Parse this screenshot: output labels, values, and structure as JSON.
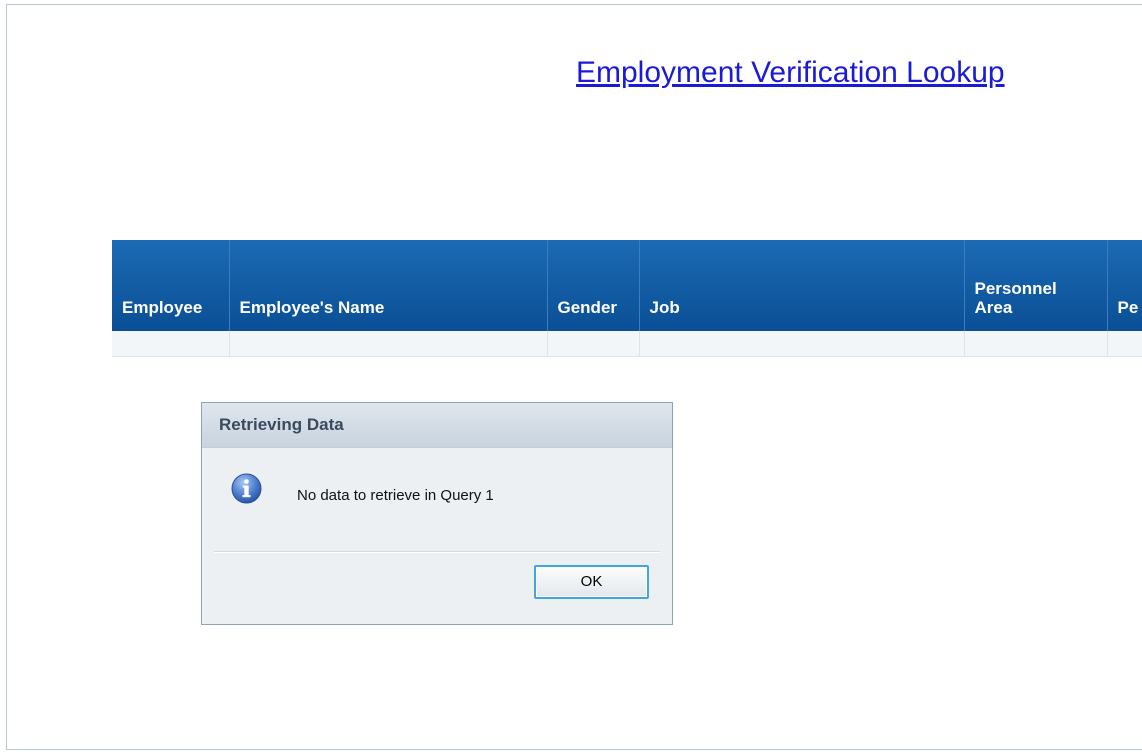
{
  "page": {
    "title": "Employment Verification Lookup"
  },
  "table": {
    "columns": [
      "Employee",
      "Employee's Name",
      "Gender",
      "Job",
      "Personnel\nArea",
      "Pe"
    ],
    "rows": [
      [
        "",
        "",
        "",
        "",
        "",
        ""
      ]
    ]
  },
  "dialog": {
    "title": "Retrieving Data",
    "icon": "info-icon",
    "message": "No data to retrieve in Query 1",
    "ok_label": "OK"
  },
  "colors": {
    "header_bg": "#0f5aa3",
    "link": "#1a1ad8",
    "dialog_bg": "#edf0f3"
  }
}
